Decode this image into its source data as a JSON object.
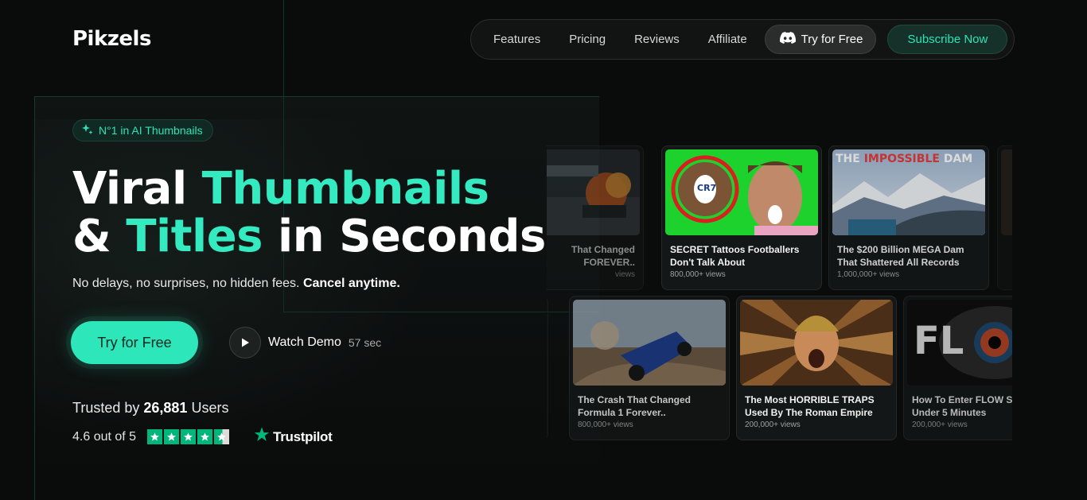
{
  "brand": {
    "logo": "Pikzels"
  },
  "nav": {
    "links": [
      "Features",
      "Pricing",
      "Reviews",
      "Affiliate"
    ],
    "discord_label": "Try for Free",
    "subscribe_label": "Subscribe Now"
  },
  "hero": {
    "badge": "N°1 in AI Thumbnails",
    "headline_w1": "Viral",
    "headline_w2": "Thumbnails",
    "headline_w3": "&",
    "headline_w4": "Titles",
    "headline_w5": "in Seconds",
    "subline_plain": "No delays, no surprises, no hidden fees.",
    "subline_bold": "Cancel anytime.",
    "cta_label": "Try for Free",
    "demo_label": "Watch Demo",
    "demo_duration": "57 sec"
  },
  "trust": {
    "trusted_prefix": "Trusted by",
    "user_count": "26,881",
    "trusted_suffix": "Users",
    "rating_text": "4.6 out of 5",
    "rating_value": 4.6,
    "rating_max": 5,
    "trustpilot_label": "Trustpilot"
  },
  "cards": [
    {
      "title_line1": "That Changed",
      "title_line2": "FOREVER..",
      "views": "views"
    },
    {
      "title_line1": "SECRET Tattoos Footballers",
      "title_line2": "Don't Talk About",
      "views": "800,000+ views",
      "thumb_text": "CR7"
    },
    {
      "title_line1": "The $200 Billion MEGA Dam",
      "title_line2": "That Shattered All Records",
      "views": "1,000,000+ views",
      "thumb_text_a": "THE",
      "thumb_text_b": "IMPOSSIBLE",
      "thumb_text_c": "DAM"
    },
    {
      "title_line1": "The Crash That Changed",
      "title_line2": "Formula 1 Forever..",
      "views": "800,000+ views"
    },
    {
      "title_line1": "The Most HORRIBLE TRAPS",
      "title_line2": "Used By The Roman Empire",
      "views": "200,000+ views"
    },
    {
      "title_line1": "How To Enter FLOW ST",
      "title_line2": "Under 5 Minutes",
      "views": "200,000+ views",
      "thumb_text": "FL"
    }
  ],
  "colors": {
    "accent": "#2de6b9",
    "background": "#0a0b0b",
    "trustpilot_green": "#00b67a"
  }
}
